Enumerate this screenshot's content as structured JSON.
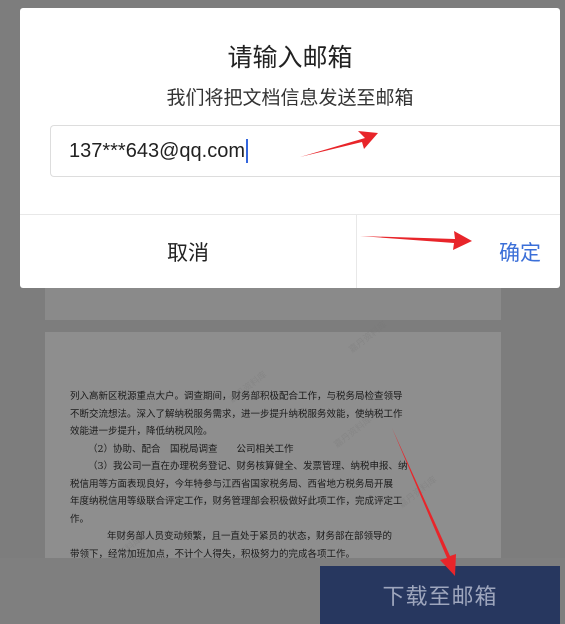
{
  "dialog": {
    "title": "请输入邮箱",
    "subtitle": "我们将把文档信息发送至邮箱",
    "email_value": "137***643@qq.com",
    "cancel_label": "取消",
    "confirm_label": "确定"
  },
  "document": {
    "lines": [
      "列入高新区税源重点大户。调查期间，财务部积极配合工作，与税务局检查领导",
      "不断交流想法。深入了解纳税服务需求，进一步提升纳税服务效能，使纳税工作",
      "效能进一步提升，降低纳税风险。",
      "（2）协助、配合　国税局调查　　公司相关工作",
      "（3）我公司一直在办理税务登记、财务核算健全、发票管理、纳税申报、纳",
      "税信用等方面表现良好，今年特参与江西省国家税务局、西省地方税务局开展",
      "年度纳税信用等级联合评定工作，财务管理部会积极做好此项工作，完成评定工",
      "作。",
      "　　年财务部人员变动频繁，且一直处于紧员的状态，财务部在部领导的",
      "带领下，经常加班加点，不计个人得失，积极努力的完成各项工作。"
    ],
    "watermark": "嘉丹资料库"
  },
  "footer": {
    "download_label": "下载至邮箱"
  },
  "colors": {
    "accent": "#3b6fd8",
    "arrow": "#e8252a",
    "download_bg": "#27375f"
  }
}
